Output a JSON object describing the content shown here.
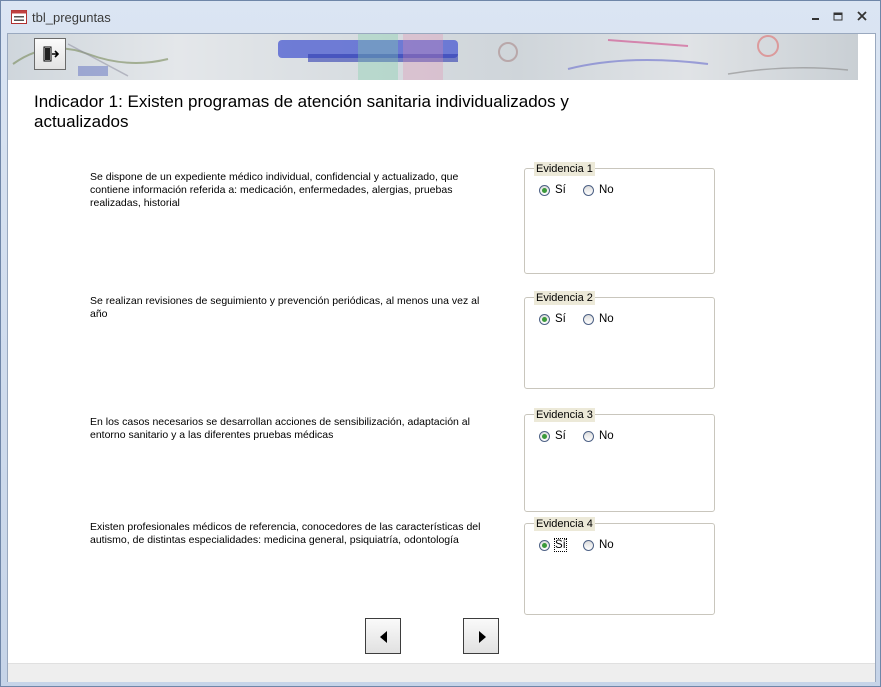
{
  "window": {
    "title": "tbl_preguntas"
  },
  "form": {
    "heading": "Indicador 1: Existen programas de atención sanitaria individualizados y actualizados"
  },
  "questions": [
    {
      "text": "Se dispone de un expediente médico individual, confidencial y actualizado, que contiene información referida a: medicación, enfermedades, alergias, pruebas realizadas, historial",
      "legend": "Evidencia 1",
      "yes": "Sí",
      "no": "No",
      "selected": "yes"
    },
    {
      "text": "Se realizan revisiones de seguimiento y prevención periódicas, al menos una vez al año",
      "legend": "Evidencia 2",
      "yes": "Sí",
      "no": "No",
      "selected": "yes"
    },
    {
      "text": "En los casos necesarios se desarrollan acciones de sensibilización, adaptación al entorno sanitario y a las diferentes pruebas médicas",
      "legend": "Evidencia 3",
      "yes": "Sí",
      "no": "No",
      "selected": "yes"
    },
    {
      "text": "Existen profesionales médicos de referencia, conocedores de las características del autismo, de distintas especialidades: medicina general, psiquiatría, odontología",
      "legend": "Evidencia 4",
      "yes": "Sí",
      "no": "No",
      "selected": "yes"
    }
  ],
  "icons": {
    "app": "form-icon",
    "exit": "exit-door-icon",
    "prev": "triangle-left-icon",
    "next": "triangle-right-icon"
  },
  "colors": {
    "radio_dot": "#3a9a3a",
    "legend_bg": "#ece9d8"
  }
}
